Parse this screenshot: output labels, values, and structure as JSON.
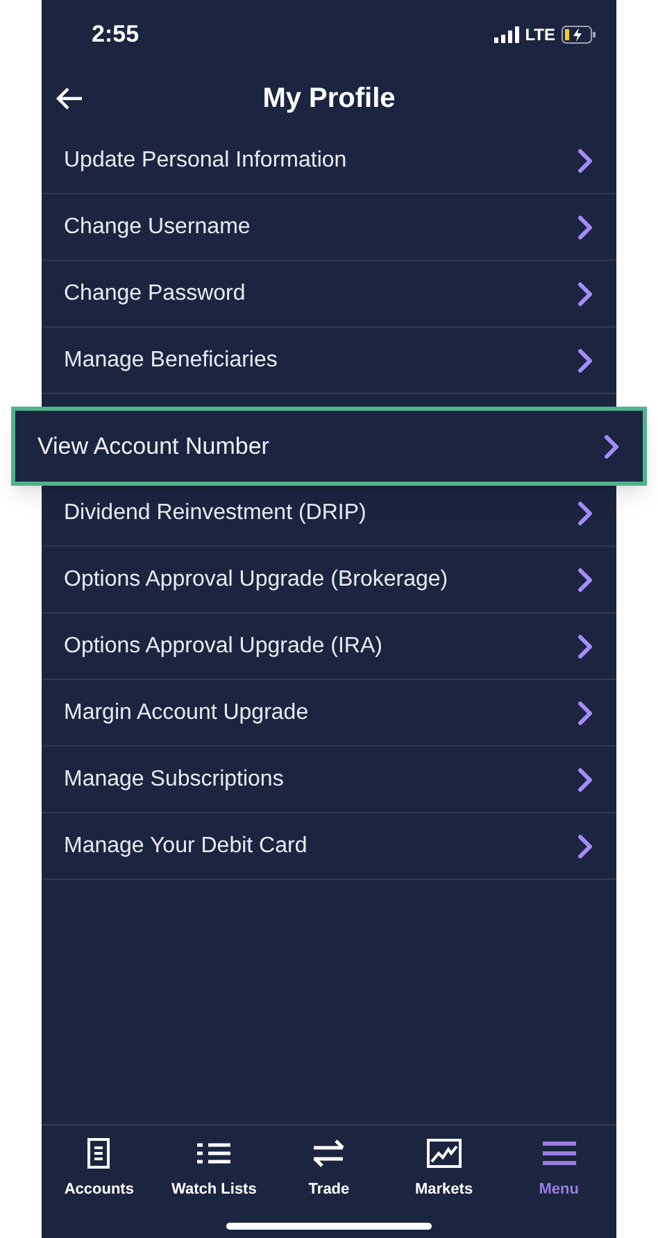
{
  "status_bar": {
    "time": "2:55",
    "network": "LTE"
  },
  "header": {
    "title": "My Profile"
  },
  "menu_items": [
    {
      "label": "Update Personal Information",
      "highlighted": false
    },
    {
      "label": "Change Username",
      "highlighted": false
    },
    {
      "label": "Change Password",
      "highlighted": false
    },
    {
      "label": "Manage Beneficiaries",
      "highlighted": false
    },
    {
      "label": "View Account Number",
      "highlighted": true
    },
    {
      "label": "Dividend Reinvestment (DRIP)",
      "highlighted": false
    },
    {
      "label": "Options Approval Upgrade (Brokerage)",
      "highlighted": false
    },
    {
      "label": "Options Approval Upgrade (IRA)",
      "highlighted": false
    },
    {
      "label": "Margin Account Upgrade",
      "highlighted": false
    },
    {
      "label": "Manage Subscriptions",
      "highlighted": false
    },
    {
      "label": "Manage Your Debit Card",
      "highlighted": false
    }
  ],
  "tab_bar": [
    {
      "kind": "accounts",
      "label": "Accounts",
      "selected": false
    },
    {
      "kind": "watchlists",
      "label": "Watch Lists",
      "selected": false
    },
    {
      "kind": "trade",
      "label": "Trade",
      "selected": false
    },
    {
      "kind": "markets",
      "label": "Markets",
      "selected": false
    },
    {
      "kind": "menu",
      "label": "Menu",
      "selected": true
    }
  ]
}
